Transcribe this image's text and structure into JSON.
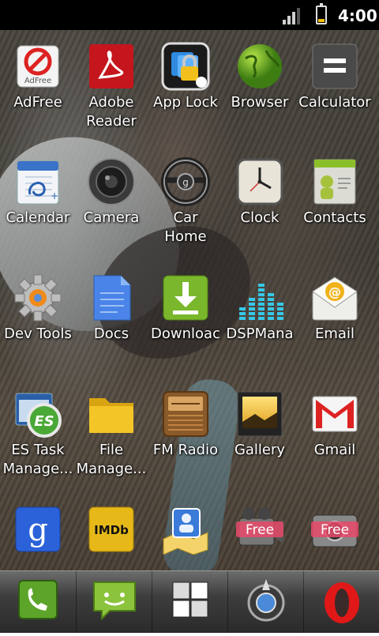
{
  "status_bar": {
    "time": "4:00",
    "battery_level": 0.2,
    "signal_bars": 3
  },
  "apps": [
    {
      "label": "AdFree",
      "icon": "adfree-icon",
      "icon_text": "AdFree"
    },
    {
      "label": "Adobe\nReader",
      "icon": "adobe-reader-icon"
    },
    {
      "label": "App Lock",
      "icon": "app-lock-icon"
    },
    {
      "label": "Browser",
      "icon": "browser-globe-icon"
    },
    {
      "label": "Calculator",
      "icon": "calculator-icon"
    },
    {
      "label": "Calendar",
      "icon": "calendar-icon"
    },
    {
      "label": "Camera",
      "icon": "camera-lens-icon"
    },
    {
      "label": "Car\nHome",
      "icon": "car-steering-wheel-icon"
    },
    {
      "label": "Clock",
      "icon": "clock-icon"
    },
    {
      "label": "Contacts",
      "icon": "contacts-icon"
    },
    {
      "label": "Dev Tools",
      "icon": "gear-icon"
    },
    {
      "label": "Docs",
      "icon": "docs-icon"
    },
    {
      "label": "Downloac",
      "icon": "download-icon"
    },
    {
      "label": "DSPMana",
      "icon": "equalizer-icon"
    },
    {
      "label": "Email",
      "icon": "email-icon"
    },
    {
      "label": "ES Task\nManage...",
      "icon": "es-task-manager-icon",
      "icon_text": "ES"
    },
    {
      "label": "File\nManage...",
      "icon": "folder-icon"
    },
    {
      "label": "FM Radio",
      "icon": "radio-icon"
    },
    {
      "label": "Gallery",
      "icon": "gallery-icon"
    },
    {
      "label": "Gmail",
      "icon": "gmail-icon",
      "icon_text": "M"
    },
    {
      "label": "",
      "icon": "google-search-icon",
      "icon_text": "g"
    },
    {
      "label": "",
      "icon": "imdb-icon",
      "icon_text": "IMDb"
    },
    {
      "label": "",
      "icon": "maps-contact-icon"
    },
    {
      "label": "",
      "icon": "free-video-icon",
      "icon_text": "Free"
    },
    {
      "label": "",
      "icon": "free-camera-icon",
      "icon_text": "Free"
    }
  ],
  "dock": [
    {
      "icon": "phone-icon"
    },
    {
      "icon": "messaging-icon"
    },
    {
      "icon": "app-drawer-grid-icon"
    },
    {
      "icon": "navigation-compass-icon"
    },
    {
      "icon": "opera-browser-icon"
    }
  ],
  "colors": {
    "statusbar_bg": "#000000",
    "battery_fill": "#f0c000",
    "label_color": "#ffffff"
  }
}
